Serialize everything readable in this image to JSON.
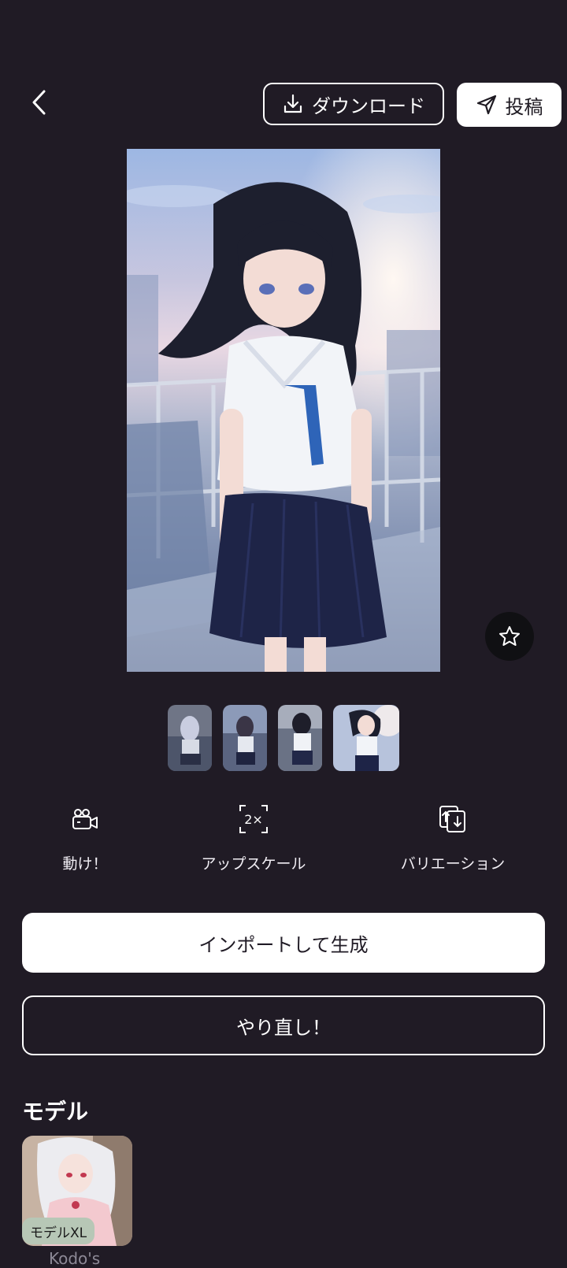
{
  "header": {
    "download_label": "ダウンロード",
    "post_label": "投稿"
  },
  "icons": {
    "back": "chevron-left-icon",
    "download": "download-icon",
    "post": "send-icon",
    "favorite": "star-icon"
  },
  "thumbnails": [
    {
      "selected": false
    },
    {
      "selected": false
    },
    {
      "selected": false
    },
    {
      "selected": true
    }
  ],
  "actions": [
    {
      "label": "動け！",
      "icon": "video-camera-icon"
    },
    {
      "label": "アップスケール",
      "icon": "upscale-2x-icon"
    },
    {
      "label": "バリエーション",
      "icon": "variation-icon"
    }
  ],
  "buttons": {
    "import_label": "インポートして生成",
    "redo_label": "やり直し！"
  },
  "model_section": {
    "title": "モデル",
    "model": {
      "badge": "モデルXL",
      "name": "Kodo's"
    }
  },
  "colors": {
    "background": "#201b25",
    "button_white": "#ffffff",
    "badge": "#b7c7b6"
  }
}
